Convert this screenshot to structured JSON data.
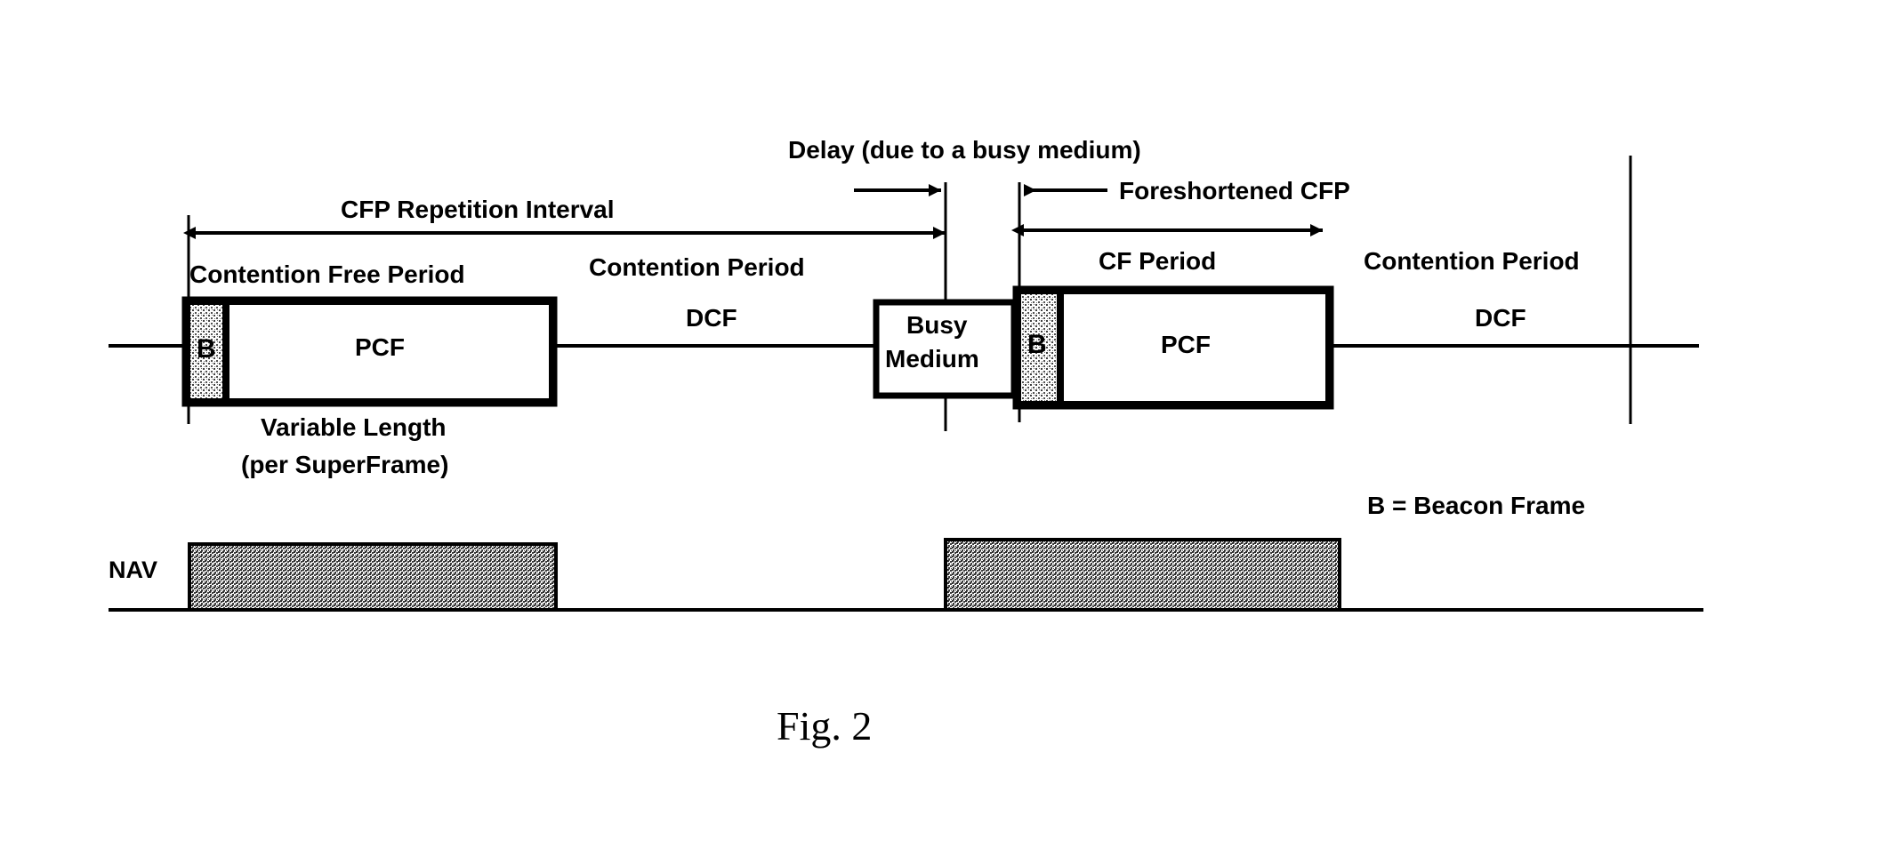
{
  "figure": {
    "caption": "Fig. 2",
    "legend": "B = Beacon Frame",
    "nav_label": "NAV"
  },
  "annotations": {
    "cfp_repetition_interval": "CFP Repetition Interval",
    "delay": "Delay (due to a busy medium)",
    "foreshortened_cfp": "Foreshortened CFP",
    "contention_free_period": "Contention Free Period",
    "contention_period_1": "Contention Period",
    "dcf_1": "DCF",
    "cf_period": "CF Period",
    "contention_period_2": "Contention Period",
    "dcf_2": "DCF",
    "variable_length_line1": "Variable Length",
    "variable_length_line2": "(per SuperFrame)"
  },
  "blocks": {
    "beacon_1": "B",
    "pcf_1": "PCF",
    "busy_medium_line1": "Busy",
    "busy_medium_line2": "Medium",
    "beacon_2": "B",
    "pcf_2": "PCF"
  },
  "colors": {
    "ink": "#000000",
    "paper": "#ffffff",
    "stipple_gray": "#9a9a9a",
    "nav_gray": "#a8a8a8"
  }
}
